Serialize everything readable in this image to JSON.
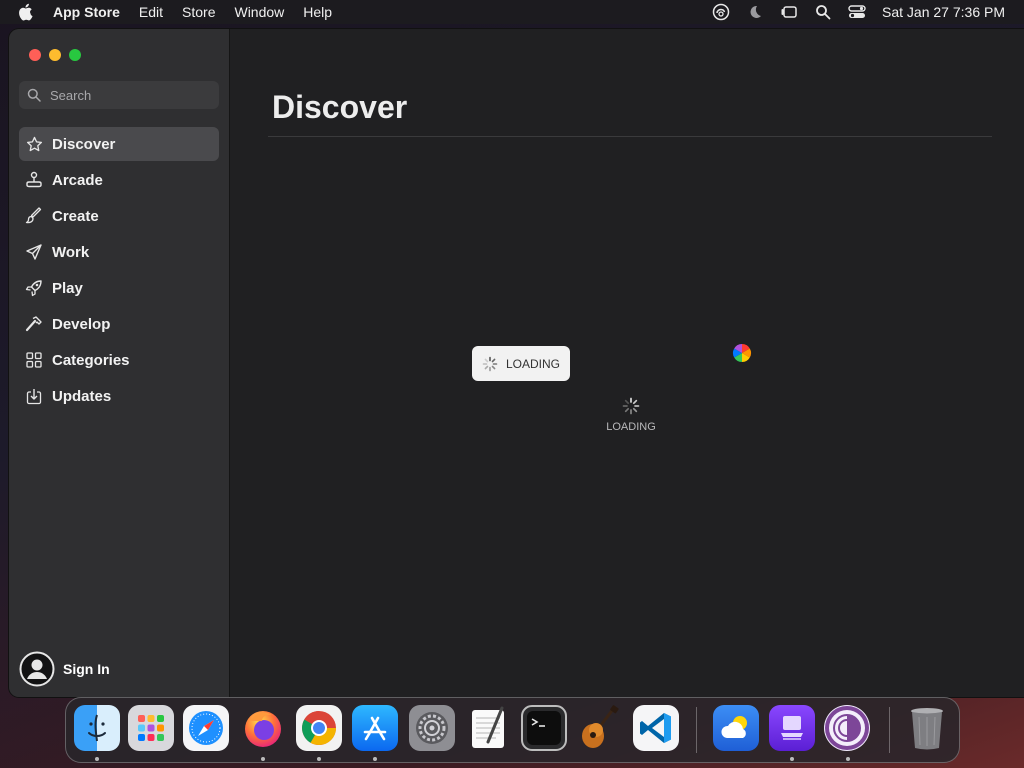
{
  "menubar": {
    "app_name": "App Store",
    "menus": [
      "Edit",
      "Store",
      "Window",
      "Help"
    ],
    "clock": "Sat Jan 27  7:36 PM",
    "status_icons": [
      "creative-cloud-icon",
      "do-not-disturb-moon-icon",
      "stage-manager-icon",
      "spotlight-search-icon",
      "control-center-icon"
    ]
  },
  "sidebar": {
    "search_placeholder": "Search",
    "items": [
      {
        "label": "Discover",
        "icon": "star-icon",
        "active": true
      },
      {
        "label": "Arcade",
        "icon": "joystick-icon",
        "active": false
      },
      {
        "label": "Create",
        "icon": "brush-icon",
        "active": false
      },
      {
        "label": "Work",
        "icon": "paper-plane-icon",
        "active": false
      },
      {
        "label": "Play",
        "icon": "rocket-icon",
        "active": false
      },
      {
        "label": "Develop",
        "icon": "hammer-icon",
        "active": false
      },
      {
        "label": "Categories",
        "icon": "grid-icon",
        "active": false
      },
      {
        "label": "Updates",
        "icon": "download-icon",
        "active": false
      }
    ],
    "sign_in": "Sign In"
  },
  "main": {
    "title": "Discover",
    "loading_pill_label": "LOADING",
    "loading_label": "LOADING"
  },
  "dock": {
    "apps": [
      "Finder",
      "Launchpad",
      "Safari",
      "Firefox",
      "Chrome",
      "App Store",
      "System Settings",
      "TextEdit",
      "Terminal",
      "GarageBand",
      "Visual Studio Code",
      "Weather",
      "Simulator",
      "Tor Browser",
      "Trash"
    ]
  },
  "colors": {
    "accent_active": "#4a4a4d",
    "traffic_red": "#ff5f57",
    "traffic_yellow": "#febc2e",
    "traffic_green": "#28c840"
  }
}
